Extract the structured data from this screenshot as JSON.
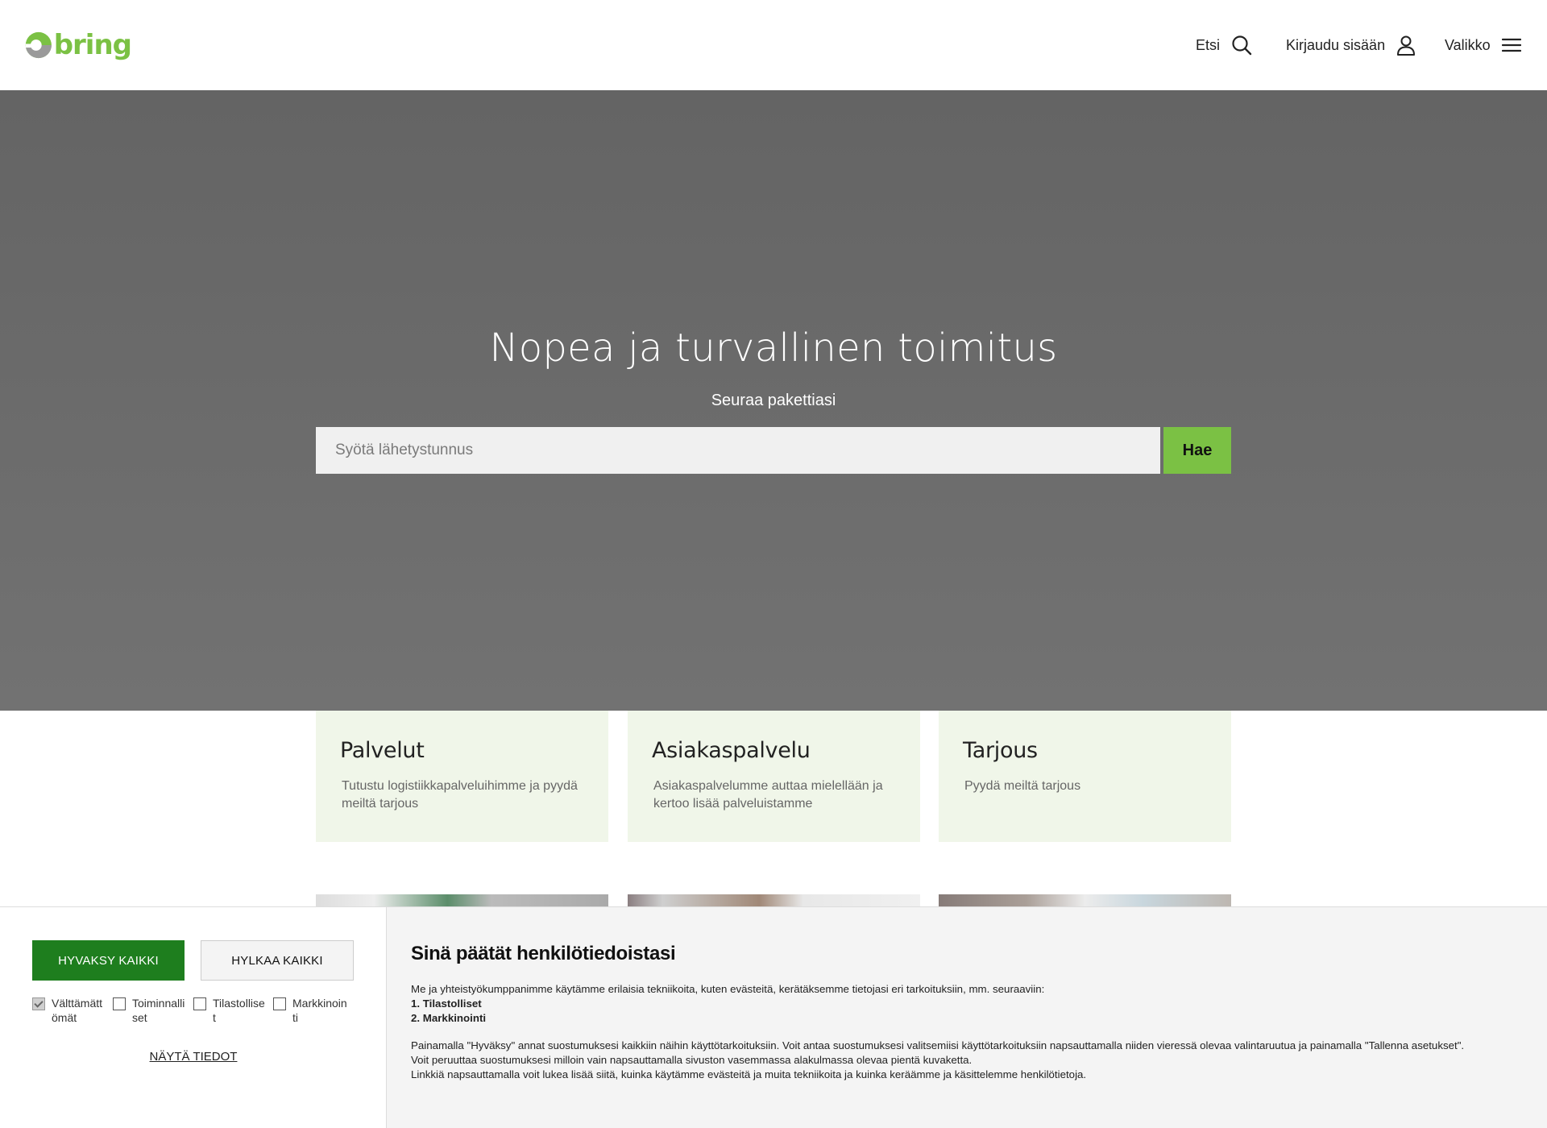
{
  "header": {
    "logo_text": "bring",
    "nav": {
      "search_label": "Etsi",
      "login_label": "Kirjaudu sisään",
      "menu_label": "Valikko"
    }
  },
  "hero": {
    "title": "Nopea ja turvallinen toimitus",
    "subtitle": "Seuraa pakettiasi",
    "tracking_placeholder": "Syötä lähetystunnus",
    "search_button": "Hae"
  },
  "cards": [
    {
      "title": "Palvelut",
      "text": "Tutustu logistiikkapalveluihimme ja pyydä meiltä tarjous"
    },
    {
      "title": "Asiakaspalvelu",
      "text": "Asiakaspalvelumme auttaa mielellään ja kertoo lisää palveluistamme"
    },
    {
      "title": "Tarjous",
      "text": "Pyydä meiltä tarjous"
    }
  ],
  "cookie": {
    "accept_all": "HYVAKSY KAIKKI",
    "reject_all": "HYLKAA KAIKKI",
    "consents": [
      {
        "label": "Välttämättömät",
        "checked": true
      },
      {
        "label": "Toiminnalliset",
        "checked": false
      },
      {
        "label": "Tilastolliset",
        "checked": false
      },
      {
        "label": "Markkinointi",
        "checked": false
      }
    ],
    "show_details": "NÄYTÄ TIEDOT",
    "title": "Sinä päätät henkilötiedoistasi",
    "intro": "Me ja yhteistyökumppanimme käytämme erilaisia tekniikoita, kuten evästeitä, kerätäksemme tietojasi eri tarkoituksiin, mm. seuraaviin:",
    "purposes": [
      "1. Tilastolliset",
      "2. Markkinointi"
    ],
    "para1": "Painamalla \"Hyväksy\" annat suostumuksesi kaikkiin näihin käyttötarkoituksiin. Voit antaa suostumuksesi valitsemiisi käyttötarkoituksiin napsauttamalla niiden vieressä olevaa valintaruutua ja painamalla \"Tallenna asetukset\".",
    "para2": "Voit peruuttaa suostumuksesi milloin vain napsauttamalla sivuston vasemmassa alakulmassa olevaa pientä kuvaketta.",
    "para3": "Linkkiä napsauttamalla voit lukea lisää siitä, kuinka käytämme evästeitä ja muita tekniikoita ja kuinka keräämme ja käsittelemme henkilötietoja."
  },
  "colors": {
    "brand_green": "#7bc144",
    "accept_green": "#1e7e1e",
    "card_bg": "#f0f6e9",
    "hero_bg": "#686868"
  },
  "icons": [
    "bring-logo-icon",
    "search-icon",
    "user-icon",
    "hamburger-menu-icon",
    "checkmark-icon"
  ]
}
